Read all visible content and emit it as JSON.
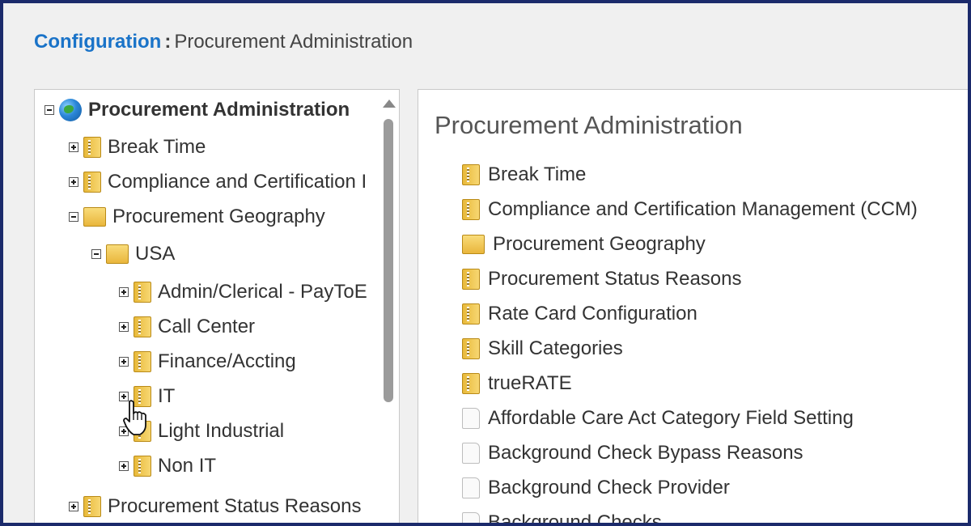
{
  "header": {
    "crumb_link": "Configuration",
    "separator": ":",
    "crumb_current": "Procurement Administration"
  },
  "tree": {
    "root": "Procurement Administration",
    "items": [
      {
        "label": "Break Time"
      },
      {
        "label": "Compliance and Certification I"
      },
      {
        "label": "Procurement Geography"
      },
      {
        "label": "USA"
      },
      {
        "label": "Admin/Clerical - PayToE"
      },
      {
        "label": "Call Center"
      },
      {
        "label": "Finance/Accting"
      },
      {
        "label": "IT"
      },
      {
        "label": "Light Industrial"
      },
      {
        "label": "Non IT"
      },
      {
        "label": "Procurement Status Reasons"
      }
    ]
  },
  "content": {
    "title": "Procurement Administration",
    "items": [
      {
        "label": "Break Time",
        "icon": "zip-folder-icon"
      },
      {
        "label": "Compliance and Certification Management (CCM)",
        "icon": "zip-folder-icon"
      },
      {
        "label": "Procurement Geography",
        "icon": "folder-icon"
      },
      {
        "label": "Procurement Status Reasons",
        "icon": "zip-folder-icon"
      },
      {
        "label": "Rate Card Configuration",
        "icon": "zip-folder-icon"
      },
      {
        "label": "Skill Categories",
        "icon": "zip-folder-icon"
      },
      {
        "label": "trueRATE",
        "icon": "zip-folder-icon"
      },
      {
        "label": "Affordable Care Act Category Field Setting",
        "icon": "page-icon"
      },
      {
        "label": "Background Check Bypass Reasons",
        "icon": "page-icon"
      },
      {
        "label": "Background Check Provider",
        "icon": "page-icon"
      },
      {
        "label": "Background Checks",
        "icon": "page-icon"
      }
    ]
  },
  "colors": {
    "frame_border": "#1b2a6b",
    "link": "#1a73c8",
    "folder": "#e8b93a"
  }
}
